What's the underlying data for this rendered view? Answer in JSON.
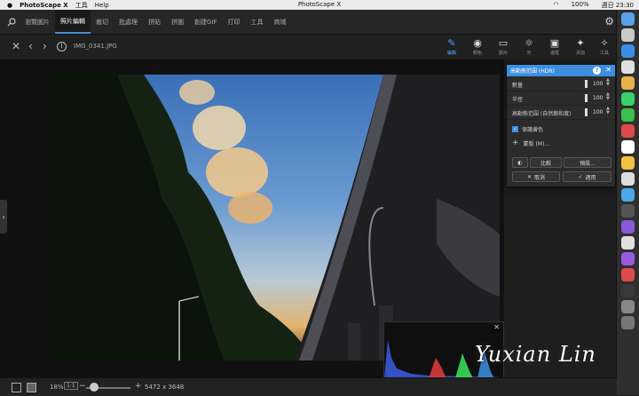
{
  "menubar": {
    "apple": "",
    "app_name": "PhotoScape X",
    "menus": [
      "工具",
      "Help"
    ],
    "window_title": "PhotoScape X",
    "battery": "100%",
    "clock": "週日 23:30"
  },
  "tabs": [
    "瀏覽圖片",
    "照片編輯",
    "裁切",
    "批處理",
    "拼貼",
    "拼圖",
    "創建GIF",
    "打印",
    "工具",
    "商城"
  ],
  "active_tab": "照片編輯",
  "file": {
    "name": "IMG_0341.JPG"
  },
  "tools": [
    {
      "label": "編輯",
      "icon": "edit-icon"
    },
    {
      "label": "顏色",
      "icon": "circle-icon"
    },
    {
      "label": "膠片",
      "icon": "film-icon"
    },
    {
      "label": "光",
      "icon": "sun-icon"
    },
    {
      "label": "邊框",
      "icon": "frame-icon"
    },
    {
      "label": "添加",
      "icon": "star-icon"
    },
    {
      "label": "工具",
      "icon": "magic-icon"
    }
  ],
  "dialog": {
    "title": "高動態范圍 (HDR)",
    "sliders": [
      {
        "label": "數量",
        "value": "100"
      },
      {
        "label": "半徑",
        "value": "100"
      },
      {
        "label": "高動態范圍 (自然飽和度)",
        "value": "100"
      }
    ],
    "protect_skin": "保護膚色",
    "mask": "蒙版 (M)...",
    "compare": "比較",
    "preset": "預設...",
    "cancel": "取消",
    "apply": "適用"
  },
  "status": {
    "zoom": "18%",
    "one_to_one": "1:1",
    "dimensions": "5472 x 3648"
  },
  "colors": {
    "accent": "#3c8fe0",
    "dialog_bg": "#2b2b2b"
  }
}
